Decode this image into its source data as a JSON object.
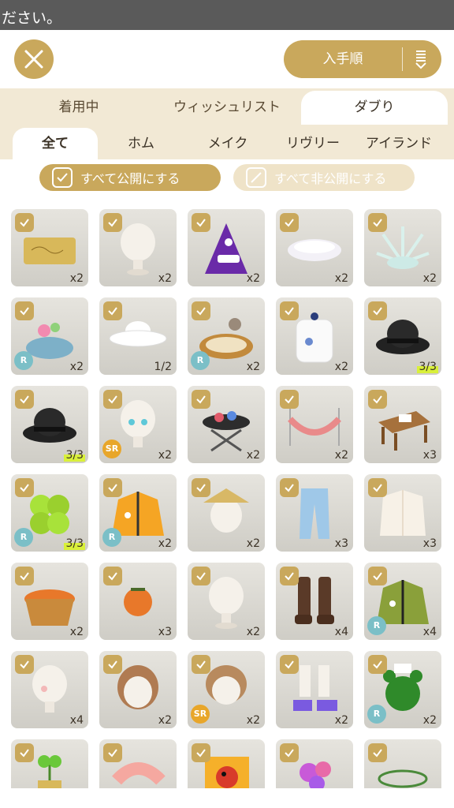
{
  "status_text": "ださい。",
  "header": {
    "close_icon": "close-icon",
    "sort_label": "入手順",
    "sort_icon": "sort-order-icon"
  },
  "tabs": [
    {
      "label": "着用中",
      "active": false
    },
    {
      "label": "ウィッシュリスト",
      "active": false
    },
    {
      "label": "ダブり",
      "active": true
    }
  ],
  "subtabs": [
    {
      "label": "全て",
      "active": true
    },
    {
      "label": "ホム",
      "active": false
    },
    {
      "label": "メイク",
      "active": false
    },
    {
      "label": "リヴリー",
      "active": false
    },
    {
      "label": "アイランド",
      "active": false
    }
  ],
  "actions": {
    "make_all_public": "すべて公開にする",
    "make_all_private": "すべて非公開にする"
  },
  "colors": {
    "accent": "#c9a85c",
    "tab_bg": "#f2e9d5",
    "count_highlight": "#d9f03a",
    "rarity_r": "#7bbfc7",
    "rarity_sr": "#e8a62a"
  },
  "items": [
    {
      "name": "gold-card",
      "count": "x2",
      "rarity": "",
      "full": false
    },
    {
      "name": "white-head",
      "count": "x2",
      "rarity": "",
      "full": false
    },
    {
      "name": "purple-monster",
      "count": "x2",
      "rarity": "",
      "full": false
    },
    {
      "name": "white-dish",
      "count": "x2",
      "rarity": "",
      "full": false
    },
    {
      "name": "white-spiky-plant",
      "count": "x2",
      "rarity": "",
      "full": false
    },
    {
      "name": "flower-turtle",
      "count": "x2",
      "rarity": "R",
      "full": false
    },
    {
      "name": "white-hat",
      "count": "1/2",
      "rarity": "",
      "full": false
    },
    {
      "name": "bunny-bed",
      "count": "x2",
      "rarity": "R",
      "full": false
    },
    {
      "name": "white-jar",
      "count": "x2",
      "rarity": "",
      "full": false
    },
    {
      "name": "black-bowler-hat",
      "count": "3/3",
      "rarity": "",
      "full": true
    },
    {
      "name": "black-bowler-hat",
      "count": "3/3",
      "rarity": "",
      "full": true
    },
    {
      "name": "blue-eye-head",
      "count": "x2",
      "rarity": "SR",
      "full": false
    },
    {
      "name": "bbq-grill",
      "count": "x2",
      "rarity": "",
      "full": false
    },
    {
      "name": "hammock",
      "count": "x2",
      "rarity": "",
      "full": false
    },
    {
      "name": "wood-table",
      "count": "x3",
      "rarity": "",
      "full": false
    },
    {
      "name": "green-clover",
      "count": "3/3",
      "rarity": "R",
      "full": true
    },
    {
      "name": "orange-jacket",
      "count": "x2",
      "rarity": "R",
      "full": false
    },
    {
      "name": "straw-hat-head",
      "count": "x2",
      "rarity": "",
      "full": false
    },
    {
      "name": "blue-jeans",
      "count": "x3",
      "rarity": "",
      "full": false
    },
    {
      "name": "white-cardigan",
      "count": "x3",
      "rarity": "",
      "full": false
    },
    {
      "name": "persimmon-basket",
      "count": "x2",
      "rarity": "",
      "full": false
    },
    {
      "name": "persimmon",
      "count": "x3",
      "rarity": "",
      "full": false
    },
    {
      "name": "white-head",
      "count": "x2",
      "rarity": "",
      "full": false
    },
    {
      "name": "brown-boots",
      "count": "x4",
      "rarity": "",
      "full": false
    },
    {
      "name": "green-jacket",
      "count": "x4",
      "rarity": "R",
      "full": false
    },
    {
      "name": "blush-head",
      "count": "x4",
      "rarity": "",
      "full": false
    },
    {
      "name": "brown-hair",
      "count": "x2",
      "rarity": "",
      "full": false
    },
    {
      "name": "short-brown-hair",
      "count": "x2",
      "rarity": "SR",
      "full": false
    },
    {
      "name": "sneakers",
      "count": "x2",
      "rarity": "",
      "full": false
    },
    {
      "name": "green-bear",
      "count": "x2",
      "rarity": "R",
      "full": false
    },
    {
      "name": "sprout-pot",
      "count": "",
      "rarity": "",
      "full": false
    },
    {
      "name": "shrimp",
      "count": "",
      "rarity": "",
      "full": false
    },
    {
      "name": "ladybug-sign",
      "count": "",
      "rarity": "",
      "full": false
    },
    {
      "name": "flower-bouquet",
      "count": "",
      "rarity": "",
      "full": false
    },
    {
      "name": "leaf-crown",
      "count": "",
      "rarity": "",
      "full": false
    }
  ]
}
